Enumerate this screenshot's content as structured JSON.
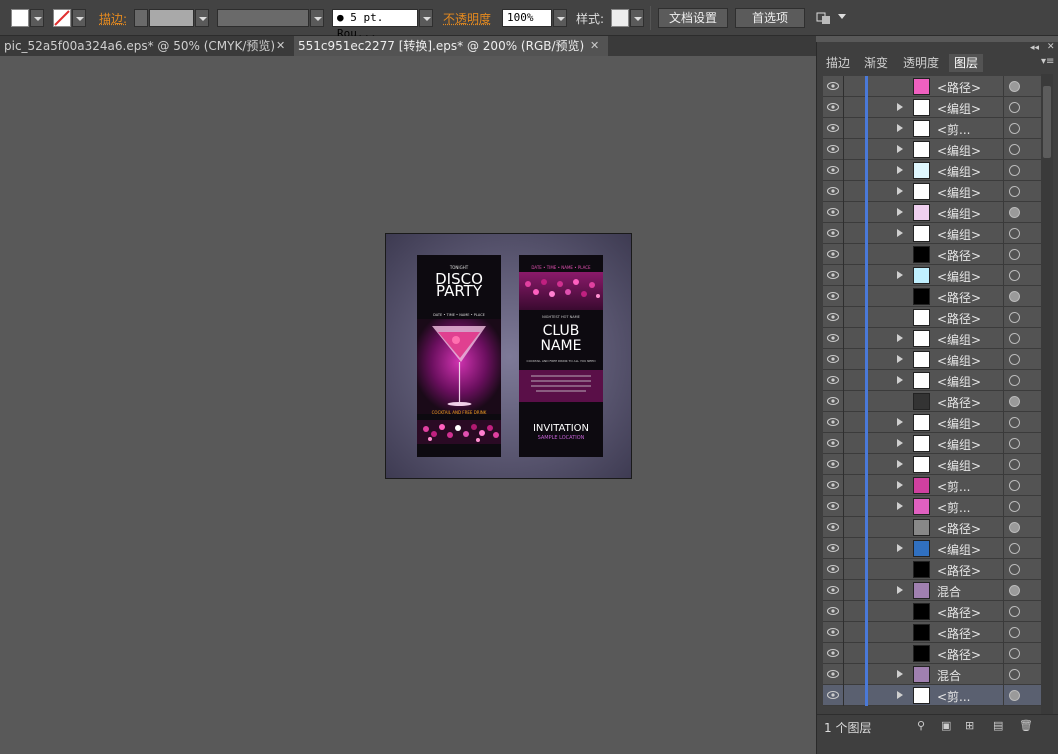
{
  "toolbar": {
    "stroke_label": "描边:",
    "opacity_label": "不透明度",
    "opacity_value": "100%",
    "brush_value": "● 5 pt. Rou...",
    "style_label": "样式:",
    "doc_setup_button": "文档设置",
    "prefs_button": "首选项"
  },
  "tabs": [
    {
      "label": "pic_52a5f00a324a6.eps* @ 50% (CMYK/预览)",
      "close": "✕"
    },
    {
      "label": "551c951ec2277  [转换].eps* @ 200% (RGB/预览)",
      "close": "✕"
    }
  ],
  "artwork": {
    "left": {
      "tonight": "TONIGHT",
      "title1": "DISCO",
      "title2": "PARTY",
      "details": "DATE • TIME • NAME • PLACE",
      "drink": "COCKTAIL AND FREE DRINK"
    },
    "right": {
      "details": "DATE • TIME • NAME • PLACE",
      "small1": "NIGHTEST HOT NAME",
      "club": "CLUB",
      "name": "NAME",
      "small2": "COCKTAIL AND FREE DRINK TO ALL YOU NEED",
      "invitation": "INVITATION",
      "location": "SAMPLE LOCATION"
    }
  },
  "panel": {
    "tabs": [
      "描边",
      "渐变",
      "透明度",
      "图层"
    ],
    "active_tab": "图层",
    "layers": [
      {
        "name": "<路径>",
        "arrow": false,
        "filled": true
      },
      {
        "name": "<编组>",
        "arrow": true,
        "filled": false
      },
      {
        "name": "<剪...",
        "arrow": true,
        "filled": false
      },
      {
        "name": "<编组>",
        "arrow": true,
        "filled": false
      },
      {
        "name": "<编组>",
        "arrow": true,
        "filled": false
      },
      {
        "name": "<编组>",
        "arrow": true,
        "filled": false
      },
      {
        "name": "<编组>",
        "arrow": true,
        "filled": true
      },
      {
        "name": "<编组>",
        "arrow": true,
        "filled": false
      },
      {
        "name": "<路径>",
        "arrow": false,
        "filled": false
      },
      {
        "name": "<编组>",
        "arrow": true,
        "filled": false
      },
      {
        "name": "<路径>",
        "arrow": false,
        "filled": true
      },
      {
        "name": "<路径>",
        "arrow": false,
        "filled": false
      },
      {
        "name": "<编组>",
        "arrow": true,
        "filled": false
      },
      {
        "name": "<编组>",
        "arrow": true,
        "filled": false
      },
      {
        "name": "<编组>",
        "arrow": true,
        "filled": false
      },
      {
        "name": "<路径>",
        "arrow": false,
        "filled": true
      },
      {
        "name": "<编组>",
        "arrow": true,
        "filled": false
      },
      {
        "name": "<编组>",
        "arrow": true,
        "filled": false
      },
      {
        "name": "<编组>",
        "arrow": true,
        "filled": false
      },
      {
        "name": "<剪...",
        "arrow": true,
        "filled": false
      },
      {
        "name": "<剪...",
        "arrow": true,
        "filled": false
      },
      {
        "name": "<路径>",
        "arrow": false,
        "filled": true
      },
      {
        "name": "<编组>",
        "arrow": true,
        "filled": false
      },
      {
        "name": "<路径>",
        "arrow": false,
        "filled": false
      },
      {
        "name": "混合",
        "arrow": true,
        "filled": true
      },
      {
        "name": "<路径>",
        "arrow": false,
        "filled": false
      },
      {
        "name": "<路径>",
        "arrow": false,
        "filled": false
      },
      {
        "name": "<路径>",
        "arrow": false,
        "filled": false
      },
      {
        "name": "混合",
        "arrow": true,
        "filled": false
      },
      {
        "name": "<剪...",
        "arrow": true,
        "filled": true
      }
    ],
    "layer_count": "1 个图层"
  }
}
